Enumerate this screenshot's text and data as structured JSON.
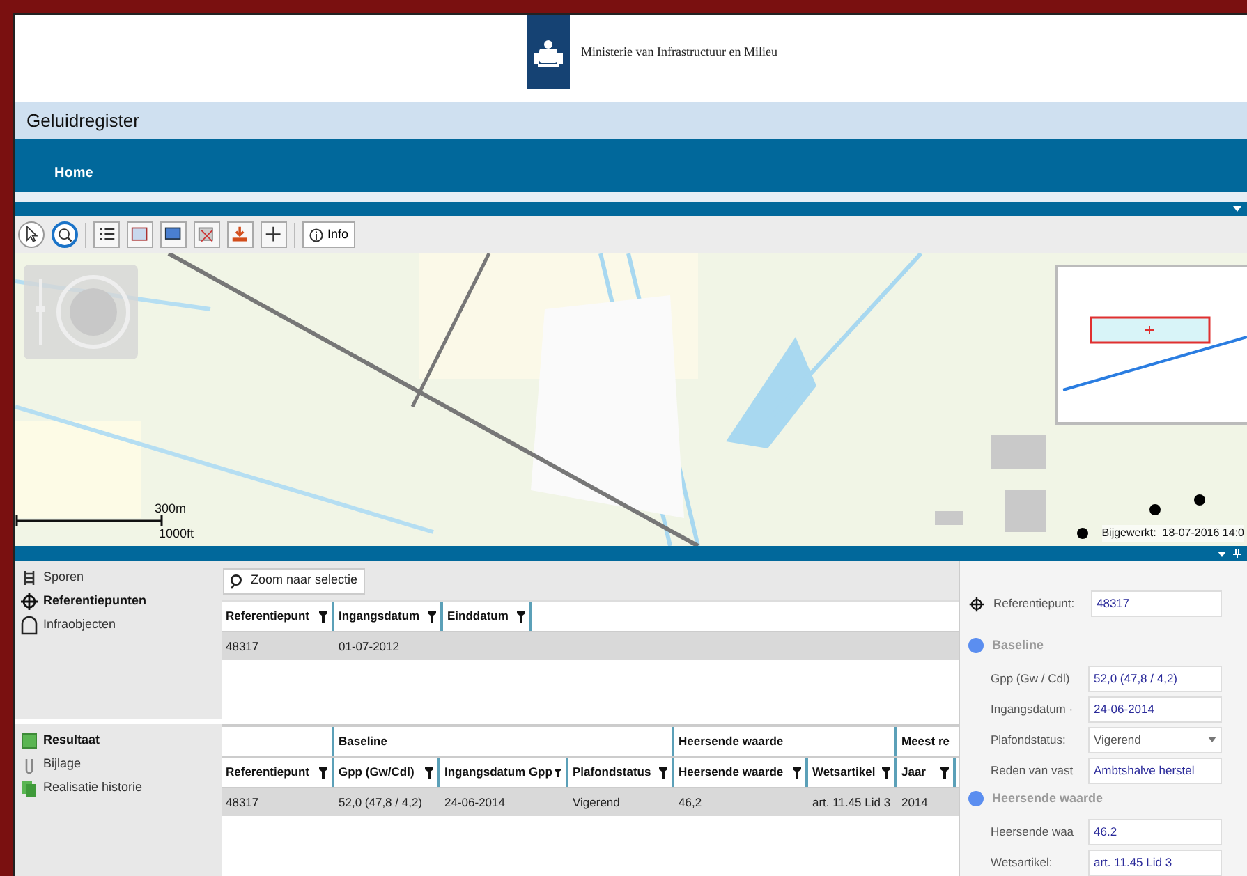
{
  "header": {
    "ministry": "Ministerie van Infrastructuur en Milieu"
  },
  "app_title": "Geluidregister",
  "nav": [
    {
      "label": "Home",
      "selected": true
    }
  ],
  "toolbar": {
    "tools": [
      {
        "kind": "pointer",
        "selected": false
      },
      {
        "kind": "zoom",
        "selected": true
      },
      {
        "kind": "list"
      },
      {
        "kind": "layers"
      },
      {
        "kind": "screen"
      },
      {
        "kind": "erase"
      },
      {
        "kind": "download"
      },
      {
        "kind": "plus"
      }
    ],
    "info": "Info"
  },
  "map": {
    "scale_top": "300m",
    "scale_bottom": "1000ft",
    "updated": "Bijgewerkt:  18-07-2016 14:0"
  },
  "top_sidebar": [
    {
      "kind": "tracks",
      "label": "Sporen",
      "selected": false
    },
    {
      "kind": "target",
      "label": "Referentiepunten",
      "selected": true
    },
    {
      "kind": "arch",
      "label": "Infraobjecten",
      "selected": false
    }
  ],
  "zoom_button": "Zoom naar selectie",
  "top_table": {
    "columns": [
      "Referentiepunt",
      "Ingangsdatum",
      "Einddatum"
    ],
    "rows": [
      {
        "cells": [
          "48317",
          "01-07-2012",
          ""
        ],
        "selected": true
      }
    ]
  },
  "bottom_sidebar": [
    {
      "kind": "green",
      "label": "Resultaat",
      "selected": true
    },
    {
      "kind": "clip",
      "label": "Bijlage",
      "selected": false
    },
    {
      "kind": "green2",
      "label": "Realisatie historie",
      "selected": false
    }
  ],
  "bottom_table": {
    "groups": [
      {
        "label": "Baseline"
      },
      {
        "label": "Heersende waarde"
      },
      {
        "label": "Meest re"
      }
    ],
    "columns": [
      "Referentiepunt",
      "Gpp (Gw/Cdl)",
      "Ingangsdatum Gpp",
      "Plafondstatus",
      "Heersende waarde",
      "Wetsartikel",
      "Jaar"
    ],
    "rows": [
      {
        "cells": [
          "48317",
          "52,0 (47,8 / 4,2)",
          "24-06-2014",
          "Vigerend",
          "46,2",
          "art. 11.45 Lid 3",
          "2014"
        ],
        "selected": true
      }
    ]
  },
  "details": {
    "referentiepunt": {
      "label": "Referentiepunt:",
      "value": "48317"
    },
    "sections": [
      {
        "title": "Baseline",
        "fields": [
          {
            "kind": "text",
            "label": "Gpp (Gw / Cdl)",
            "value": "52,0 (47,8 / 4,2)"
          },
          {
            "kind": "text",
            "label": "Ingangsdatum ·",
            "value": "24-06-2014"
          },
          {
            "kind": "select",
            "label": "Plafondstatus:",
            "value": "Vigerend"
          },
          {
            "kind": "text",
            "label": "Reden van vast",
            "value": "Ambtshalve herstel"
          }
        ]
      },
      {
        "title": "Heersende waarde",
        "fields": [
          {
            "kind": "text",
            "label": "Heersende waa",
            "value": "46.2"
          },
          {
            "kind": "text",
            "label": "Wetsartikel:",
            "value": "art. 11.45 Lid 3"
          }
        ]
      }
    ]
  }
}
